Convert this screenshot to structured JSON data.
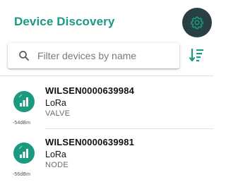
{
  "header": {
    "title": "Device Discovery",
    "settings_icon": "gear-icon",
    "accent_color": "#1a9b80",
    "settings_bg_color": "#284044"
  },
  "search": {
    "placeholder": "Filter devices by name",
    "value": "",
    "icon": "search-icon"
  },
  "sort": {
    "icon": "sort-descending-icon"
  },
  "devices": [
    {
      "name": "WILSEN0000639984",
      "protocol": "LoRa",
      "type": "VALVE",
      "signal": "-54dBm",
      "icon": "signal-strength-icon"
    },
    {
      "name": "WILSEN0000639981",
      "protocol": "LoRa",
      "type": "NODE",
      "signal": "-56dBm",
      "icon": "signal-strength-icon"
    }
  ]
}
